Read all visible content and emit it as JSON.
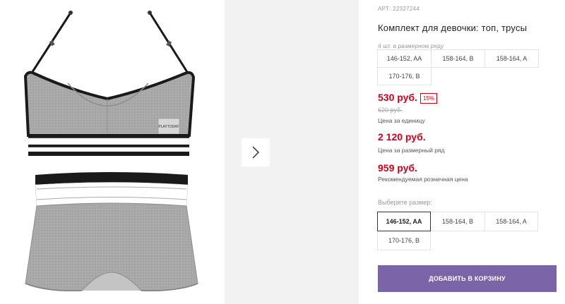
{
  "product": {
    "article": "АРТ: 22327244",
    "title": "Комплект для девочки: топ, трусы",
    "pack_label": "4 шт. в размерном ряду",
    "pack_sizes": [
      "146-152, AA",
      "158-164, B",
      "158-164, A",
      "170-176, B"
    ]
  },
  "pricing": {
    "unit_price": "530 руб.",
    "discount": "15%",
    "old_price": "620 руб.",
    "unit_note": "Цена за единицу",
    "row_price": "2 120 руб.",
    "row_note": "Цена за размерный ряд",
    "retail_price": "959 руб.",
    "retail_note": "Рекомендуемая розничная цена"
  },
  "size_select": {
    "label": "Выберите размер:",
    "options": [
      "146-152, AA",
      "158-164, B",
      "158-164, A",
      "170-176, B"
    ],
    "selected": "146-152, AA"
  },
  "cart": {
    "add_label": "ДОБАВИТЬ В КОРЗИНУ"
  },
  "gallery": {
    "next_icon": "chevron-right-icon",
    "brand_tag": "PLAYTODAY"
  },
  "colors": {
    "accent_red": "#d0021b",
    "button_purple": "#7b64a8",
    "fabric_gray": "#a9a9a9"
  }
}
